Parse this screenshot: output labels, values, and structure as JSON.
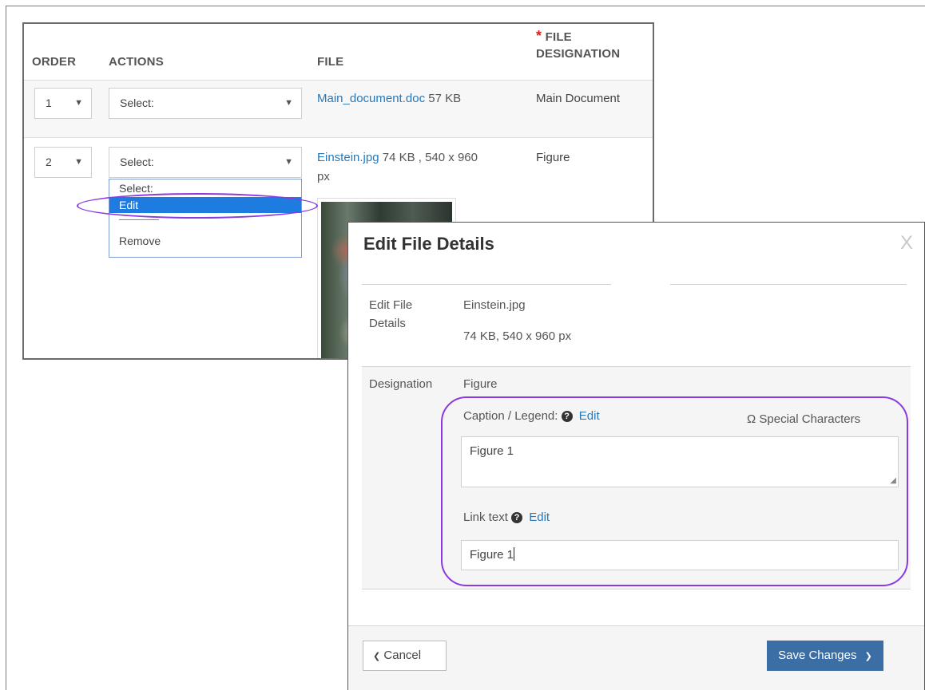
{
  "table": {
    "headers": {
      "order": "ORDER",
      "actions": "ACTIONS",
      "file": "FILE",
      "designation_star": "*",
      "designation_line1": "FILE",
      "designation_line2": "DESIGNATION"
    },
    "rows": [
      {
        "order": "1",
        "action": "Select:",
        "file_name": "Main_document.doc",
        "file_meta": " 57 KB",
        "designation": "Main Document"
      },
      {
        "order": "2",
        "action": "Select:",
        "file_name": "Einstein.jpg",
        "file_meta": " 74 KB , 540 x 960",
        "file_meta2": "px",
        "designation": "Figure"
      }
    ],
    "dropdown_options": [
      "Select:",
      "Edit",
      "—————",
      "Remove"
    ]
  },
  "modal": {
    "title": "Edit File Details",
    "close": "X",
    "details_label_1": "Edit File",
    "details_label_2": "Details",
    "file_name": "Einstein.jpg",
    "file_info": "74 KB, 540 x 960 px",
    "designation_label": "Designation",
    "designation_value": "Figure",
    "caption_label": "Caption / Legend:",
    "caption_edit": "Edit",
    "special_chars": "Ω Special Characters",
    "caption_value": "Figure 1",
    "link_text_label": "Link text",
    "link_text_edit": "Edit",
    "link_text_value": "Figure 1",
    "cancel_label": "Cancel",
    "save_label": "Save Changes"
  },
  "icons": {
    "dropdown_arrow": "▼",
    "help": "?",
    "chevron_left": "❮",
    "chevron_right": "❯"
  },
  "colors": {
    "link": "#2878b8",
    "highlight_oval": "#8a3ae0",
    "selected_option": "#1e7be0",
    "primary_button": "#3b6ea5",
    "required_star": "#d9241e"
  }
}
